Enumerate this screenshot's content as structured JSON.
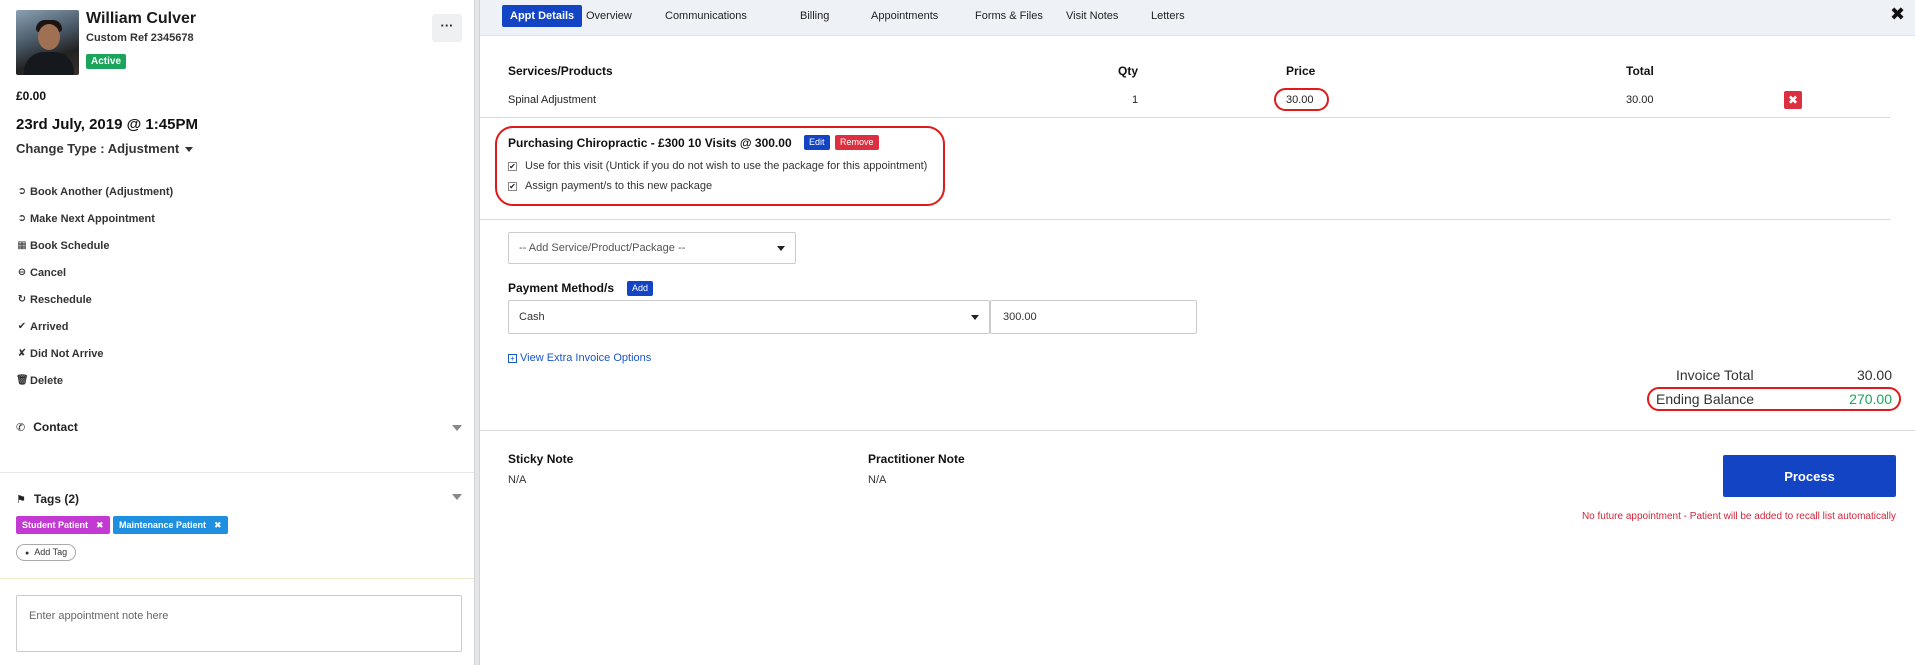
{
  "patient": {
    "name": "William Culver",
    "custom_ref": "Custom Ref 2345678",
    "status": "Active",
    "balance": "£0.00",
    "appointment_datetime": "23rd July, 2019 @ 1:45PM",
    "change_type": "Change Type : Adjustment",
    "more_label": "···"
  },
  "actions": [
    {
      "icon": "arrow-circle-icon",
      "glyph": "➲",
      "label": "Book Another (Adjustment)"
    },
    {
      "icon": "arrow-circle-icon",
      "glyph": "➲",
      "label": "Make Next Appointment"
    },
    {
      "icon": "calendar-icon",
      "glyph": "▦",
      "label": "Book Schedule"
    },
    {
      "icon": "minus-circle-icon",
      "glyph": "⊖",
      "label": "Cancel"
    },
    {
      "icon": "refresh-icon",
      "glyph": "↻",
      "label": "Reschedule"
    },
    {
      "icon": "user-check-icon",
      "glyph": "✔",
      "label": "Arrived"
    },
    {
      "icon": "user-times-icon",
      "glyph": "✘",
      "label": "Did Not Arrive"
    },
    {
      "icon": "trash-icon",
      "glyph": "🗑",
      "label": "Delete"
    }
  ],
  "contact": {
    "label": "Contact",
    "icon_glyph": "✆"
  },
  "tags": {
    "label": "Tags (2)",
    "icon_glyph": "⚑",
    "items": [
      {
        "label": "Student Patient",
        "color": "#c23ad1"
      },
      {
        "label": "Maintenance Patient",
        "color": "#1f8fe0"
      }
    ],
    "add_label": "Add Tag",
    "add_glyph": "●"
  },
  "note": {
    "placeholder": "Enter appointment note here"
  },
  "tabs": [
    "Appt Details",
    "Overview",
    "Communications",
    "Billing",
    "Appointments",
    "Forms & Files",
    "Visit Notes",
    "Letters"
  ],
  "close_glyph": "✖",
  "invoice": {
    "headers": {
      "service": "Services/Products",
      "qty": "Qty",
      "price": "Price",
      "total": "Total"
    },
    "rows": [
      {
        "service": "Spinal Adjustment",
        "qty": "1",
        "price": "30.00",
        "total": "30.00",
        "delete_glyph": "✖"
      }
    ],
    "package": {
      "title": "Purchasing Chiropractic - £300 10 Visits @ 300.00",
      "edit_label": "Edit",
      "remove_label": "Remove",
      "options": [
        "Use for this visit (Untick if you do not wish to use the package for this appointment)",
        "Assign payment/s to this new package"
      ]
    },
    "add_service_placeholder": "-- Add Service/Product/Package --",
    "payment": {
      "label": "Payment Method/s",
      "add_label": "Add",
      "method": "Cash",
      "amount": "300.00"
    },
    "extra_options_link": "View Extra Invoice Options",
    "invoice_total_label": "Invoice Total",
    "invoice_total_value": "30.00",
    "ending_balance_label": "Ending Balance",
    "ending_balance_value": "270.00"
  },
  "notes": {
    "sticky_label": "Sticky Note",
    "sticky_value": "N/A",
    "practitioner_label": "Practitioner Note",
    "practitioner_value": "N/A"
  },
  "process_label": "Process",
  "warning": "No future appointment - Patient will be added to recall list automatically",
  "colors": {
    "primary": "#1244c4",
    "active_green": "#1aa55b",
    "danger": "#dc3040",
    "balance_green": "#1aa55b",
    "annotation_red": "#e01a1a"
  }
}
